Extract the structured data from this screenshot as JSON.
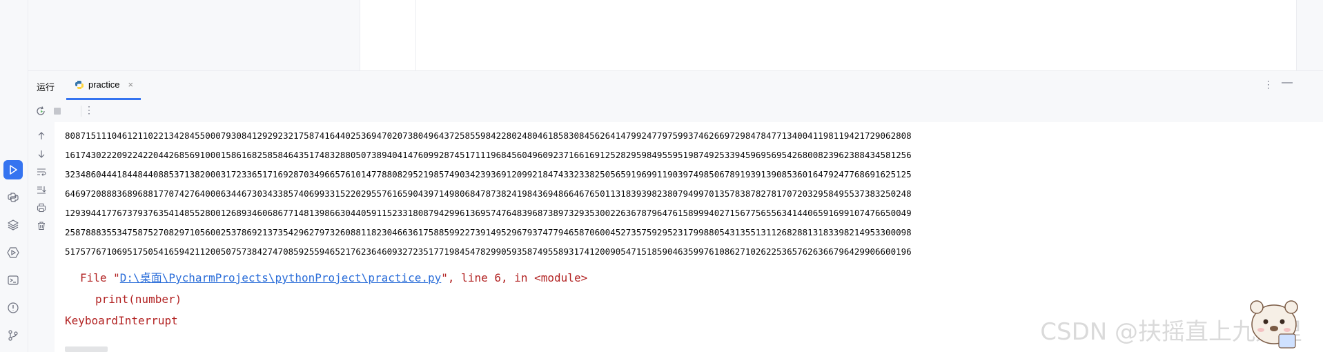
{
  "tool_window": {
    "title": "运行",
    "tab_label": "practice",
    "tab_close": "×",
    "more": "⋮",
    "minimize": "—"
  },
  "toolbar": {
    "more": "⋮"
  },
  "console": {
    "lines": [
      "8087151110461211022134284550007930841292923217587416440253694702073804964372585598422802480461858308456264147992477975993746266972984784771340041198119421729062808",
      "1617430222092242204426856910001586168258584643517483288050738940414760992874517111968456049609237166169125282959849559519874925339459695695426800823962388434581256",
      "3234860444184484408853713820003172336517169287034966576101477880829521985749034239369120992184743323382505659196991190397498506789193913908536016479247768691625125",
      "6469720888368968817707427640006344673034338574069933152202955761659043971498068478738241984369486646765011318393982380794997013578387827817072032958495537383250248",
      "1293944177673793763541485528001268934606867714813986630440591152331808794299613695747648396873897329353002263678796476158999402715677565563414406591699107476650049",
      "2587888355347587527082971056002537869213735429627973260881182304663617588599227391495296793747794658706004527357592952317998805431355131126828813183398214953300098",
      "5175776710695175054165942112005075738427470859255946521762364609327235177198454782990593587495589317412009054715185904635997610862710262253657626366796429906600196"
    ],
    "error_file_prefix": "File \"",
    "error_file_path": "D:\\桌面\\PycharmProjects\\pythonProject\\practice.py",
    "error_file_suffix": "\", line 6, in <module>",
    "error_code": "print(number)",
    "error_name": "KeyboardInterrupt"
  },
  "watermark": "CSDN @扶摇直上九万里"
}
